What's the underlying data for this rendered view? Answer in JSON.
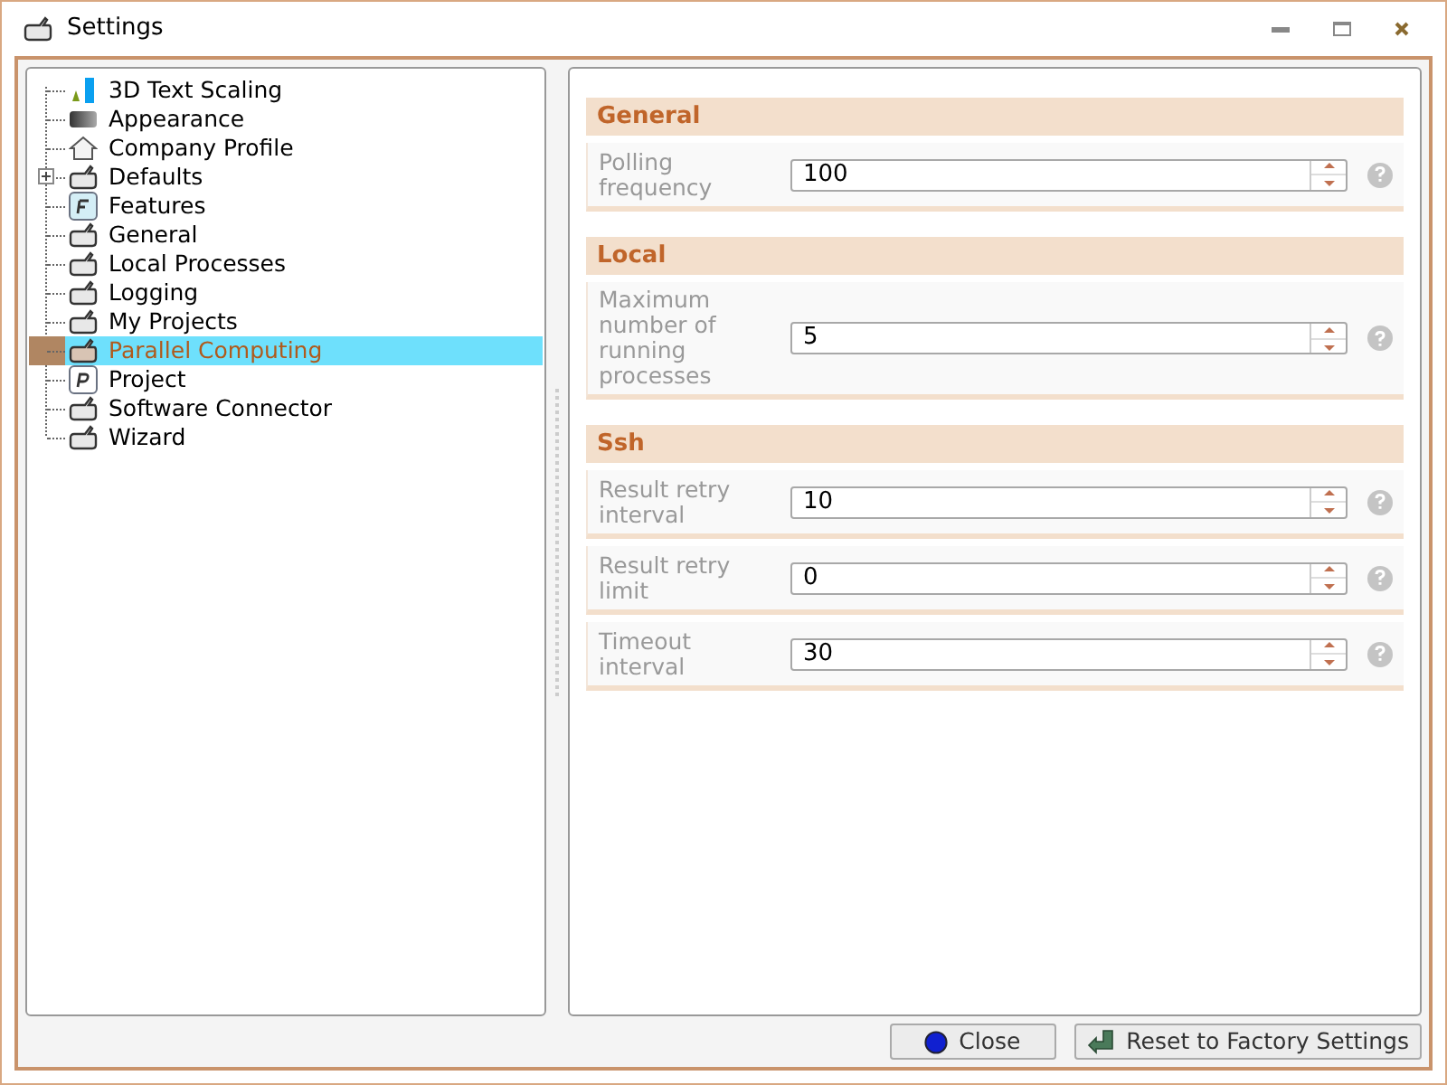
{
  "window": {
    "title": "Settings"
  },
  "tree": {
    "items": [
      {
        "label": "3D Text Scaling",
        "kind": "scaling",
        "selected": false
      },
      {
        "label": "Appearance",
        "kind": "gradient",
        "selected": false
      },
      {
        "label": "Company Profile",
        "kind": "home",
        "selected": false
      },
      {
        "label": "Defaults",
        "kind": "tool",
        "selected": false,
        "expanded": false
      },
      {
        "label": "Features",
        "kind": "letter-f",
        "selected": false
      },
      {
        "label": "General",
        "kind": "tool",
        "selected": false
      },
      {
        "label": "Local Processes",
        "kind": "tool",
        "selected": false
      },
      {
        "label": "Logging",
        "kind": "tool",
        "selected": false
      },
      {
        "label": "My Projects",
        "kind": "tool",
        "selected": false
      },
      {
        "label": "Parallel Computing",
        "kind": "tool",
        "selected": true
      },
      {
        "label": "Project",
        "kind": "letter-p",
        "selected": false
      },
      {
        "label": "Software Connector",
        "kind": "tool",
        "selected": false
      },
      {
        "label": "Wizard",
        "kind": "tool",
        "selected": false
      }
    ]
  },
  "sections": [
    {
      "title": "General",
      "fields": [
        {
          "label": "Polling frequency",
          "value": "100"
        }
      ]
    },
    {
      "title": "Local",
      "fields": [
        {
          "label": "Maximum number of running processes",
          "value": "5"
        }
      ]
    },
    {
      "title": "Ssh",
      "fields": [
        {
          "label": "Result retry interval",
          "value": "10"
        },
        {
          "label": "Result retry limit",
          "value": "0"
        },
        {
          "label": "Timeout interval",
          "value": "30"
        }
      ]
    }
  ],
  "buttons": [
    {
      "label": "Close",
      "kind": "close"
    },
    {
      "label": "Reset to Factory Settings",
      "kind": "reset"
    }
  ]
}
